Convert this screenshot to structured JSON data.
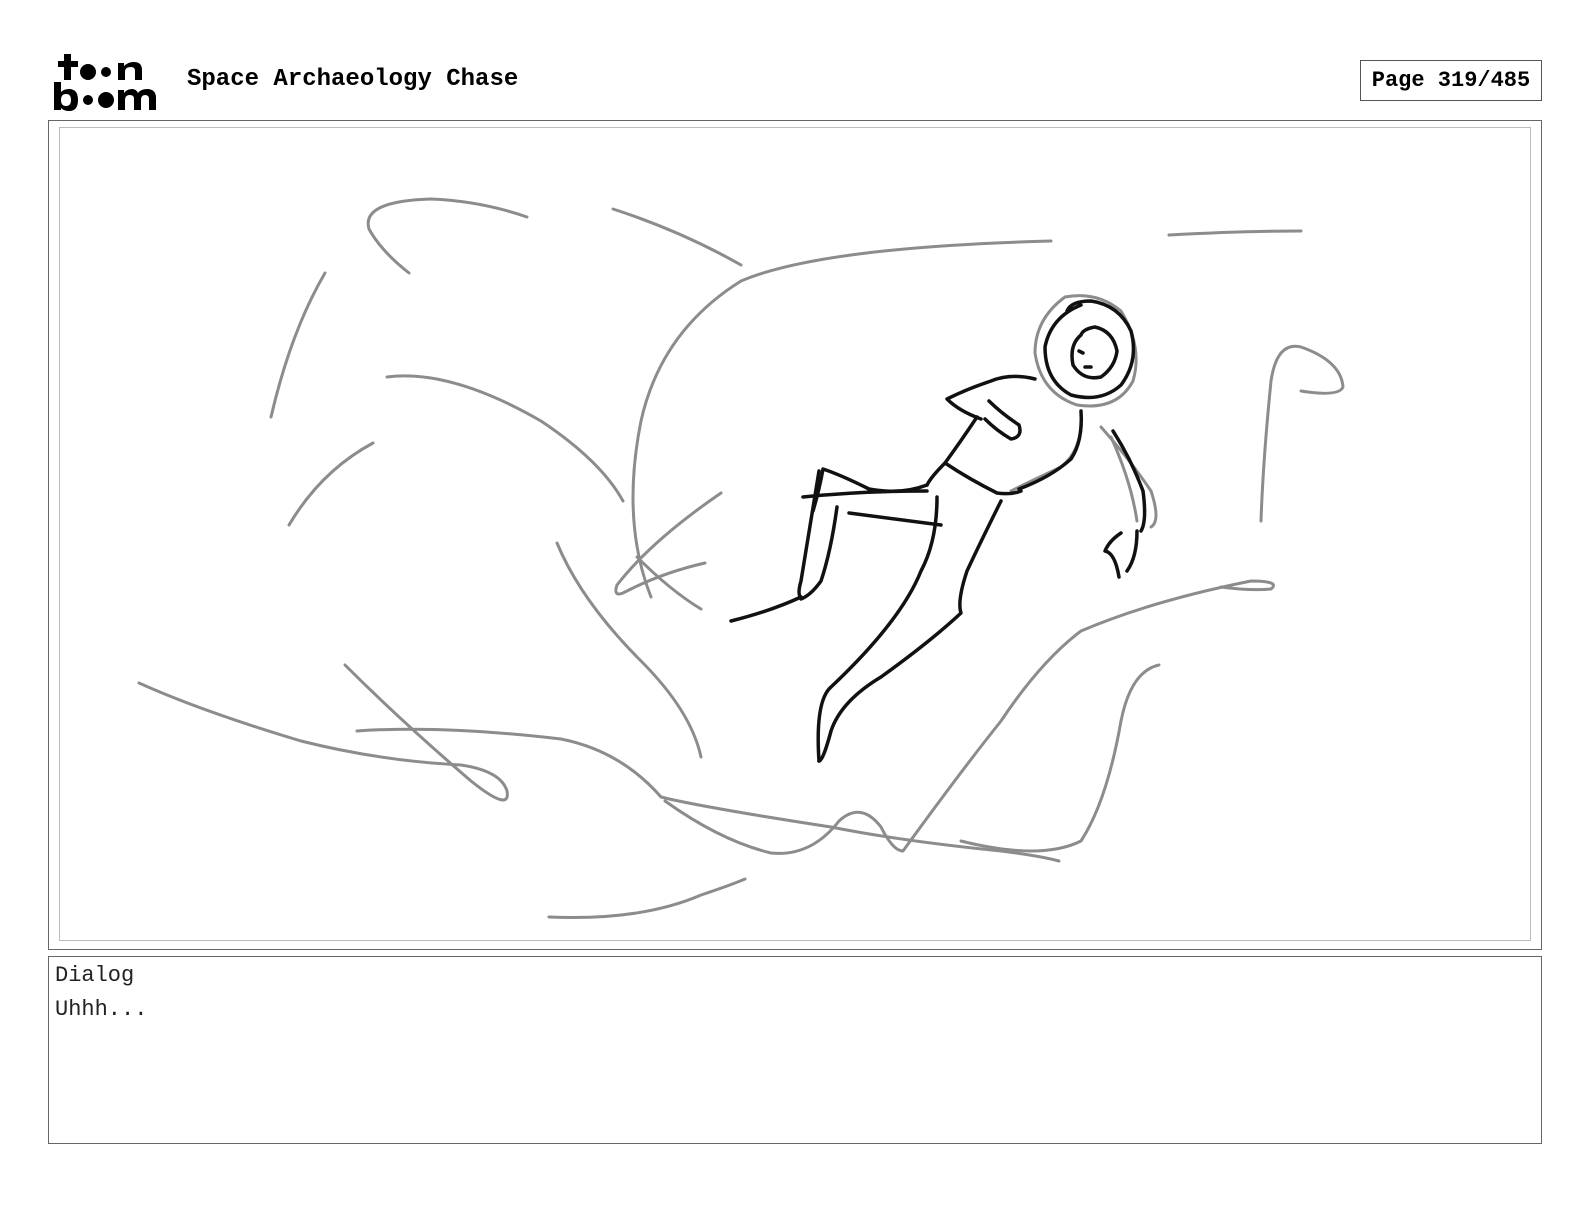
{
  "header": {
    "logo_alt": "toon boom",
    "project_title": "Space Archaeology Chase",
    "page_label": "Page 319/485"
  },
  "panel": {
    "subject": "sketch",
    "colors": {
      "rough": "#8c8c8c",
      "ink": "#111111"
    }
  },
  "dialog": {
    "label": "Dialog",
    "text": "Uhhh..."
  }
}
